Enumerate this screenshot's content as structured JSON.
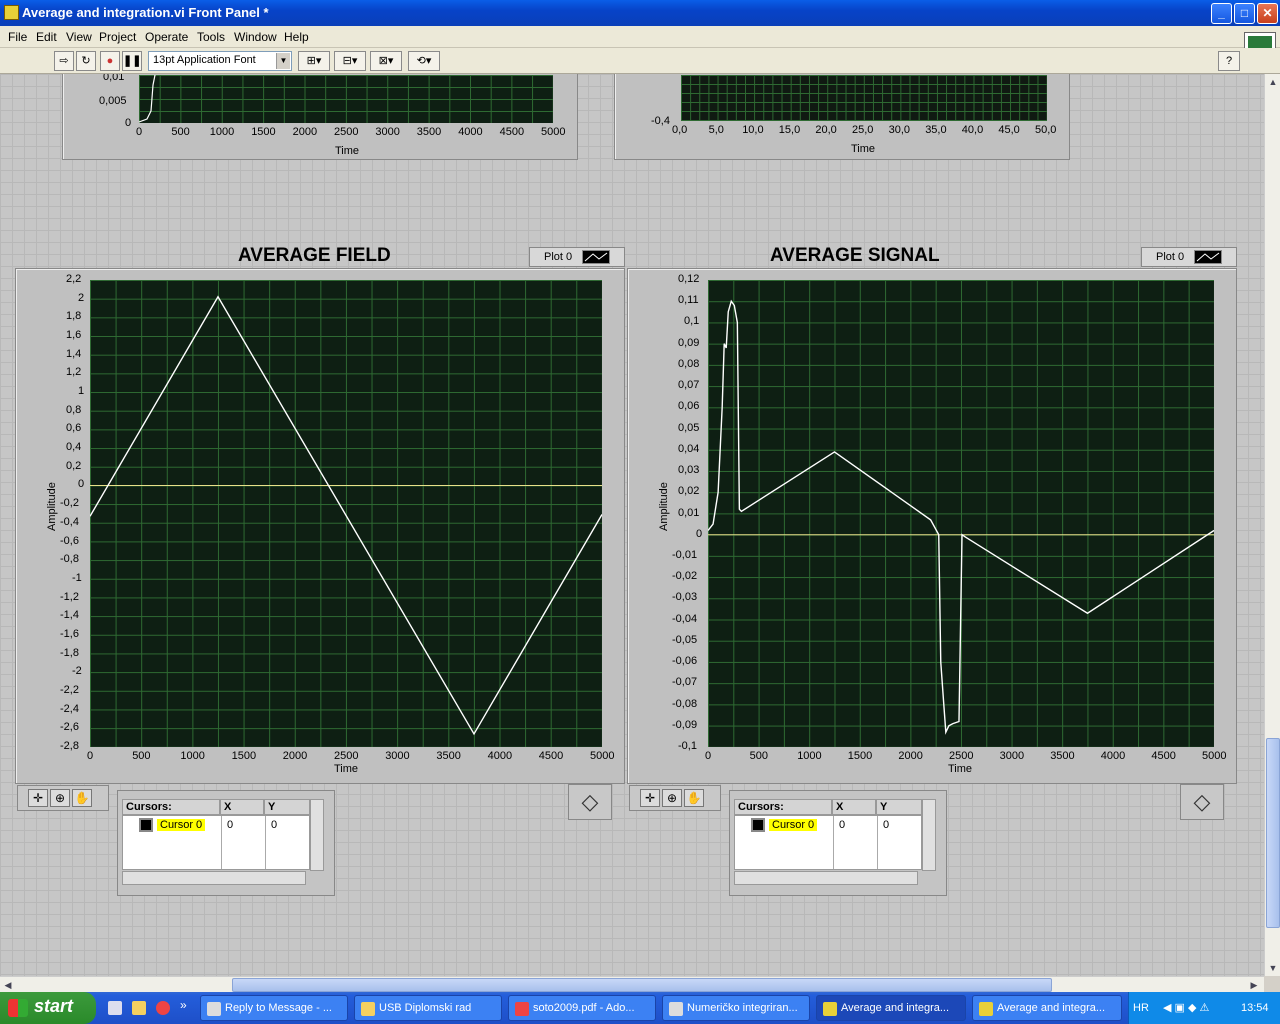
{
  "window": {
    "title": "Average and integration.vi Front Panel *",
    "min": "_",
    "max": "□",
    "close": "✕"
  },
  "menu": [
    "File",
    "Edit",
    "View",
    "Project",
    "Operate",
    "Tools",
    "Window",
    "Help"
  ],
  "toolbar": {
    "font": "13pt Application Font",
    "help": "?"
  },
  "top_left_graph": {
    "xlabel": "Time",
    "yticks": [
      "0,01",
      "0,005",
      "0"
    ],
    "xticks": [
      "0",
      "500",
      "1000",
      "1500",
      "2000",
      "2500",
      "3000",
      "3500",
      "4000",
      "4500",
      "5000"
    ]
  },
  "top_right_graph": {
    "xlabel": "Time",
    "yticks": [
      "-0,4"
    ],
    "xticks": [
      "0,0",
      "5,0",
      "10,0",
      "15,0",
      "20,0",
      "25,0",
      "30,0",
      "35,0",
      "40,0",
      "45,0",
      "50,0"
    ]
  },
  "field": {
    "title": "AVERAGE FIELD",
    "legend": "Plot 0",
    "ylabel": "Amplitude",
    "xlabel": "Time",
    "yticks": [
      "2,2",
      "2",
      "1,8",
      "1,6",
      "1,4",
      "1,2",
      "1",
      "0,8",
      "0,6",
      "0,4",
      "0,2",
      "0",
      "-0,2",
      "-0,4",
      "-0,6",
      "-0,8",
      "-1",
      "-1,2",
      "-1,4",
      "-1,6",
      "-1,8",
      "-2",
      "-2,2",
      "-2,4",
      "-2,6",
      "-2,8"
    ],
    "xticks": [
      "0",
      "500",
      "1000",
      "1500",
      "2000",
      "2500",
      "3000",
      "3500",
      "4000",
      "4500",
      "5000"
    ],
    "cursor_hdr": "Cursors:",
    "col_x": "X",
    "col_y": "Y",
    "cursor_name": "Cursor 0",
    "cursor_x": "0",
    "cursor_y": "0"
  },
  "signal": {
    "title": "AVERAGE SIGNAL",
    "legend": "Plot 0",
    "ylabel": "Amplitude",
    "xlabel": "Time",
    "yticks": [
      "0,12",
      "0,11",
      "0,1",
      "0,09",
      "0,08",
      "0,07",
      "0,06",
      "0,05",
      "0,04",
      "0,03",
      "0,02",
      "0,01",
      "0",
      "-0,01",
      "-0,02",
      "-0,03",
      "-0,04",
      "-0,05",
      "-0,06",
      "-0,07",
      "-0,08",
      "-0,09",
      "-0,1"
    ],
    "xticks": [
      "0",
      "500",
      "1000",
      "1500",
      "2000",
      "2500",
      "3000",
      "3500",
      "4000",
      "4500",
      "5000"
    ],
    "cursor_hdr": "Cursors:",
    "col_x": "X",
    "col_y": "Y",
    "cursor_name": "Cursor 0",
    "cursor_x": "0",
    "cursor_y": "0"
  },
  "chart_data": [
    {
      "type": "line",
      "title": "AVERAGE FIELD",
      "xlabel": "Time",
      "ylabel": "Amplitude",
      "xlim": [
        0,
        5000
      ],
      "ylim": [
        -2.8,
        2.2
      ],
      "grid": true,
      "series": [
        {
          "name": "Plot 0",
          "x": [
            0,
            1250,
            3750,
            5000
          ],
          "y": [
            -0.33,
            2.02,
            -2.66,
            -0.31
          ],
          "color": "#ffffff"
        }
      ],
      "reference_line_y": 0
    },
    {
      "type": "line",
      "title": "AVERAGE SIGNAL",
      "xlabel": "Time",
      "ylabel": "Amplitude",
      "xlim": [
        0,
        5000
      ],
      "ylim": [
        -0.1,
        0.12
      ],
      "grid": true,
      "series": [
        {
          "name": "Plot 0",
          "x": [
            0,
            50,
            100,
            140,
            160,
            180,
            200,
            230,
            260,
            290,
            310,
            330,
            1250,
            2200,
            2280,
            2300,
            2330,
            2350,
            2380,
            2420,
            2480,
            2510,
            2540,
            3750,
            5000
          ],
          "y": [
            0.002,
            0.005,
            0.02,
            0.06,
            0.09,
            0.088,
            0.105,
            0.11,
            0.108,
            0.1,
            0.012,
            0.011,
            0.039,
            0.007,
            0.0,
            -0.06,
            -0.08,
            -0.093,
            -0.09,
            -0.089,
            -0.088,
            0.0,
            -0.001,
            -0.037,
            0.002
          ],
          "color": "#ffffff"
        }
      ],
      "reference_line_y": 0
    }
  ],
  "taskbar": {
    "start": "start",
    "tasks": [
      "Reply to Message - ...",
      "USB Diplomski rad",
      "soto2009.pdf - Ado...",
      "Numeričko integriran...",
      "Average and integra...",
      "Average and integra..."
    ],
    "lang": "HR",
    "clock": "13:54"
  }
}
